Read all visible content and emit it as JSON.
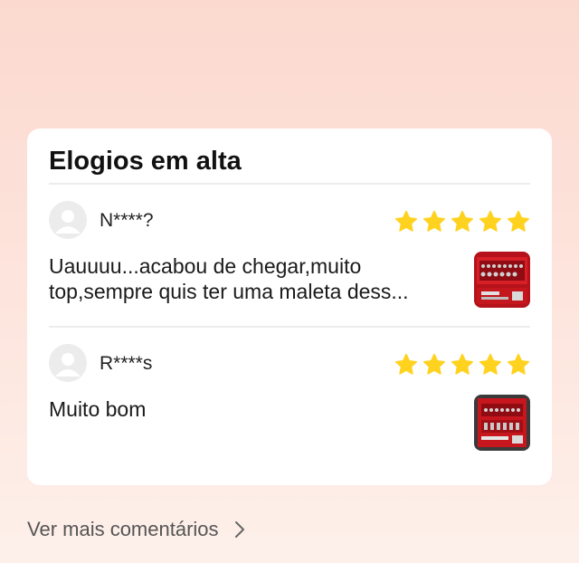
{
  "section": {
    "title": "Elogios em alta"
  },
  "reviews": [
    {
      "username": "N****?",
      "rating": 5,
      "text": "Uauuuu...acabou de chegar,muito top,sempre quis ter uma maleta dess...",
      "photo_icon": "toolkit-photo-icon"
    },
    {
      "username": "R****s",
      "rating": 5,
      "text": "Muito bom",
      "photo_icon": "toolkit-photo-icon"
    }
  ],
  "footer": {
    "see_more_label": "Ver mais comentários"
  },
  "colors": {
    "star": "#ffd21f",
    "background_top": "#fbd9cf",
    "card": "#ffffff"
  }
}
